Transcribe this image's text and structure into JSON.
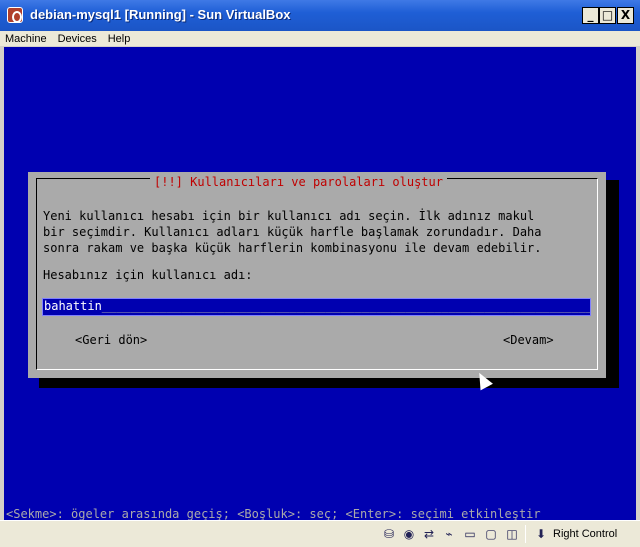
{
  "window": {
    "title": "debian-mysql1 [Running] - Sun VirtualBox",
    "buttons": {
      "minimize": "_",
      "maximize": "□",
      "close": "X"
    }
  },
  "menu": [
    "Machine",
    "Devices",
    "Help"
  ],
  "dialog": {
    "title": "[!!] Kullanıcıları ve parolaları oluştur",
    "description": "Yeni kullanıcı hesabı için bir kullanıcı adı seçin. İlk adınız makul\nbir seçimdir. Kullanıcı adları küçük harfle başlamak zorundadır. Daha\nsonra rakam ve başka küçük harflerin kombinasyonu ile devam edebilir.",
    "prompt": "Hesabınız için kullanıcı adı:",
    "input_value": "bahattin",
    "back_button": "<Geri dön>",
    "continue_button": "<Devam>"
  },
  "help_line": "<Sekme>: ögeler arasında geçiş; <Boşluk>: seç; <Enter>: seçimi etkinleştir",
  "statusbar": {
    "icons": [
      "hard-disk-icon",
      "cd-rom-icon",
      "network-icon",
      "usb-icon",
      "shared-folders-icon",
      "display-icon",
      "mouse-integration-icon"
    ],
    "host_key": "Right Control"
  },
  "colors": {
    "console_bg": "#0000b0",
    "dialog_bg": "#aaaaaa",
    "dialog_title": "#c00000",
    "titlebar": "#1f5fd6"
  }
}
